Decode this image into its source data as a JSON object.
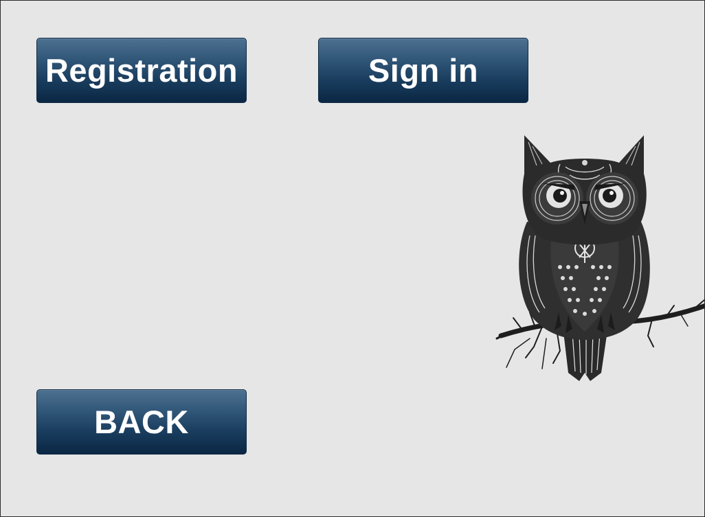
{
  "buttons": {
    "registration": "Registration",
    "sign_in": "Sign in",
    "back": "BACK"
  },
  "illustration": {
    "icon": "owl-illustration"
  },
  "colors": {
    "background": "#e6e6e6",
    "button_top": "#4d7190",
    "button_bottom": "#0a2743",
    "button_text": "#ffffff"
  }
}
